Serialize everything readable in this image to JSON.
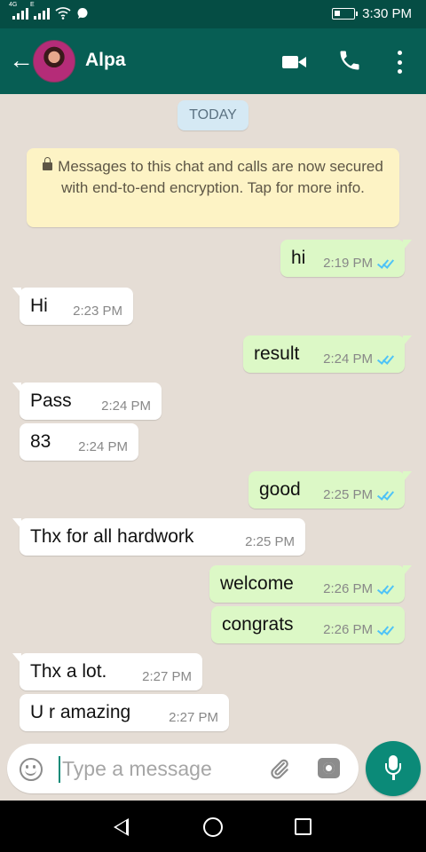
{
  "status_bar": {
    "network_label_1": "4G",
    "network_label_2": "E",
    "time": "3:30 PM"
  },
  "header": {
    "back_icon": "arrow-left-icon",
    "contact_name": "Alpa",
    "actions": [
      "video-call-icon",
      "voice-call-icon",
      "more-vertical-icon"
    ]
  },
  "chat": {
    "date_label": "TODAY",
    "encryption_notice": "Messages to this chat and calls are now secured with end-to-end encryption. Tap for more info.",
    "messages": [
      {
        "direction": "out",
        "text": "hi",
        "time": "2:19 PM",
        "read": true
      },
      {
        "direction": "in",
        "text": "Hi",
        "time": "2:23 PM"
      },
      {
        "direction": "out",
        "text": "result",
        "time": "2:24 PM",
        "read": true
      },
      {
        "direction": "in",
        "text": "Pass",
        "time": "2:24 PM"
      },
      {
        "direction": "in",
        "text": "83",
        "time": "2:24 PM"
      },
      {
        "direction": "out",
        "text": "good",
        "time": "2:25 PM",
        "read": true
      },
      {
        "direction": "in",
        "text": "Thx for all hardwork",
        "time": "2:25 PM"
      },
      {
        "direction": "out",
        "text": "welcome",
        "time": "2:26 PM",
        "read": true
      },
      {
        "direction": "out",
        "text": "congrats",
        "time": "2:26 PM",
        "read": true
      },
      {
        "direction": "in",
        "text": "Thx a lot.",
        "time": "2:27 PM"
      },
      {
        "direction": "in",
        "text": "U r amazing",
        "time": "2:27 PM"
      }
    ]
  },
  "composer": {
    "placeholder": "Type a message",
    "value": "",
    "icons": [
      "emoji-icon",
      "paperclip-icon",
      "camera-icon",
      "microphone-icon"
    ]
  },
  "colors": {
    "header": "#075e54",
    "status_bar": "#054d44",
    "chat_background": "#e5ddd5",
    "outgoing_bubble": "#dcf8c6",
    "incoming_bubble": "#ffffff",
    "read_ticks": "#4fc3f7",
    "mic_button": "#0b8a78"
  }
}
